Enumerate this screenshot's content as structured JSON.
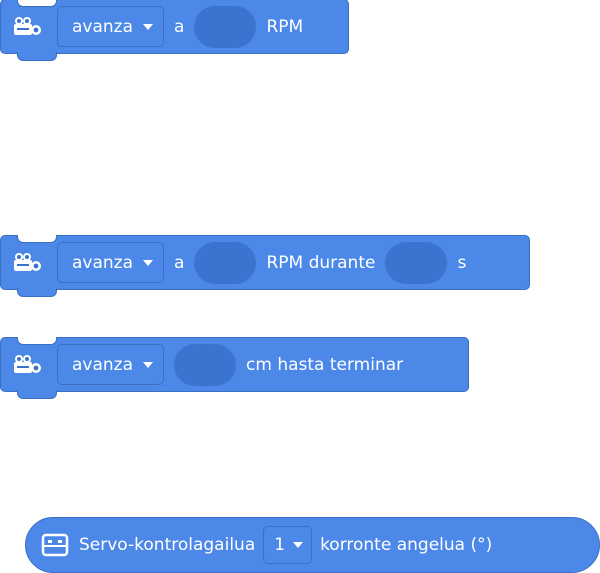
{
  "block1": {
    "direction": "avanza",
    "word_a": "a",
    "rpm": "RPM"
  },
  "block2": {
    "direction": "avanza",
    "word_a": "a",
    "rpm_durante": "RPM durante",
    "unit_s": "s"
  },
  "block3": {
    "direction": "avanza",
    "cm_text": "cm hasta terminar"
  },
  "servo": {
    "label": "Servo-kontrolagailua",
    "port": "1",
    "suffix": "korronte angelua (°)"
  },
  "icons": {
    "robot": "robot-motor-icon",
    "screen": "screen-icon",
    "dropdown": "caret-down-icon"
  },
  "colors": {
    "block": "#4c88e8",
    "border": "#3a6fc4",
    "slot": "#3b73d0"
  }
}
